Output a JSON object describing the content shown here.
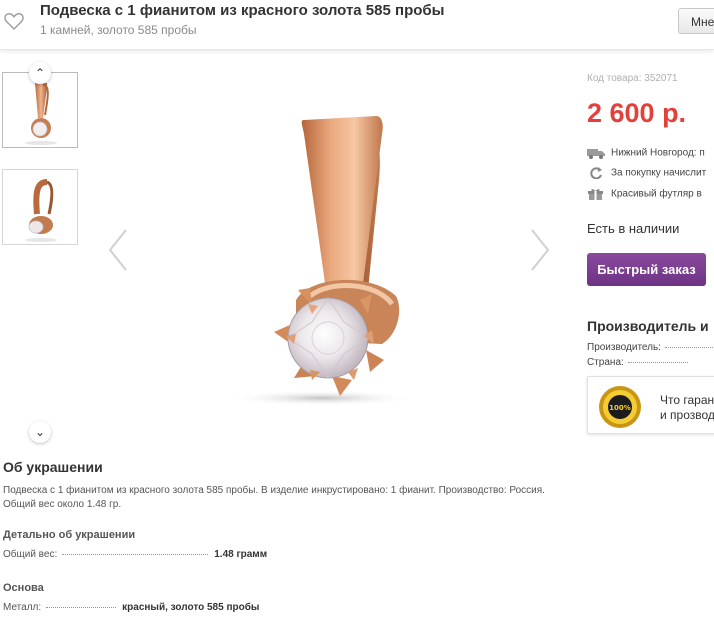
{
  "header": {
    "title": "Подвеска с 1 фианитом из красного золота 585 пробы",
    "subtitle": "1 камней, золото 585 пробы",
    "button_label": "Мне"
  },
  "gallery": {
    "thumbnails": [
      "pendant-front-thumbnail",
      "pendant-side-thumbnail"
    ],
    "arrow_up": "⌃",
    "arrow_down": "⌄"
  },
  "product": {
    "sku": "Код товара: 352071",
    "price": "2 600 р.",
    "features": [
      {
        "icon": "truck-icon",
        "text": "Нижний Новгород: п"
      },
      {
        "icon": "refresh-icon",
        "text": "За покупку начислит"
      },
      {
        "icon": "gift-icon",
        "text": "Красивый футляр в"
      }
    ],
    "stock": "Есть в наличии",
    "quick_order": "Быстрый заказ"
  },
  "manufacturer": {
    "heading": "Производитель и",
    "rows": [
      {
        "label": "Производитель:"
      },
      {
        "label": "Страна:"
      }
    ],
    "guarantee_text_1": "Что гаран",
    "guarantee_text_2": "и прозвод",
    "seal_label": "100%"
  },
  "about": {
    "heading": "Об украшении",
    "description": "Подвеска с 1 фианитом из красного золота 585 пробы. В изделие инкрустировано: 1 фианит. Производство: Россия. Общий вес около 1.48 гр.",
    "detail_heading": "Детально об украшении",
    "weight_label": "Общий вес:",
    "weight_value": "1.48 грамм",
    "base_heading": "Основа",
    "metal_label": "Металл:",
    "metal_value": "красный, золото 585 пробы"
  },
  "colors": {
    "price": "#e2403a",
    "button": "#7a3d8f",
    "gold": "#d9946a"
  }
}
